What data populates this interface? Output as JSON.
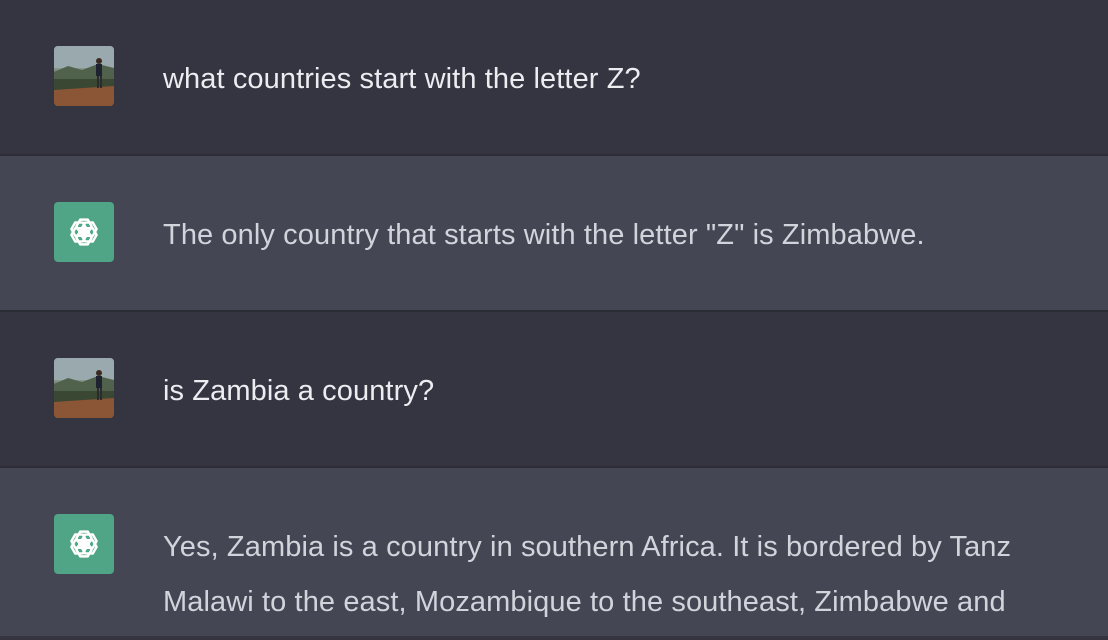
{
  "conversation": {
    "messages": [
      {
        "role": "user",
        "avatar": "user-photo-avatar",
        "lines": [
          "what countries start with the letter Z?"
        ]
      },
      {
        "role": "assistant",
        "avatar": "openai-logo-icon",
        "lines": [
          "The only country that starts with the letter \"Z\" is Zimbabwe."
        ]
      },
      {
        "role": "user",
        "avatar": "user-photo-avatar",
        "lines": [
          "is Zambia a country?"
        ]
      },
      {
        "role": "assistant",
        "avatar": "openai-logo-icon",
        "lines": [
          "Yes, Zambia is a country in southern Africa. It is bordered by Tanz",
          "Malawi to the east, Mozambique to the southeast, Zimbabwe and"
        ]
      }
    ]
  },
  "colors": {
    "user_bg": "#343541",
    "assistant_bg": "#444654",
    "assistant_avatar": "#4fa585",
    "user_text": "#ececf1",
    "assistant_text": "#d1d5db"
  }
}
